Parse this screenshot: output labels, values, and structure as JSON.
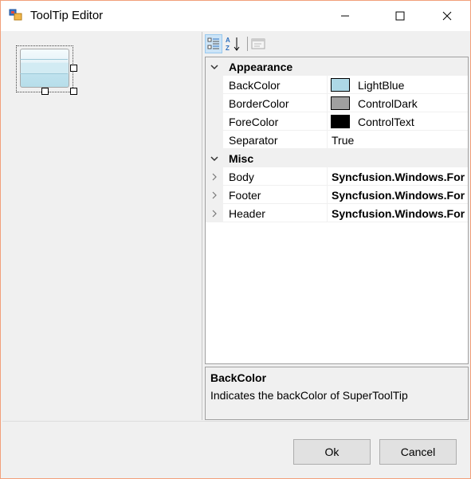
{
  "window": {
    "title": "ToolTip Editor"
  },
  "property_grid": {
    "categories": [
      {
        "label": "Appearance",
        "items": [
          {
            "name": "BackColor",
            "value": "LightBlue",
            "swatch": "#add8e6"
          },
          {
            "name": "BorderColor",
            "value": "ControlDark",
            "swatch": "#a0a0a0"
          },
          {
            "name": "ForeColor",
            "value": "ControlText",
            "swatch": "#000000"
          },
          {
            "name": "Separator",
            "value": "True"
          }
        ]
      },
      {
        "label": "Misc",
        "items": [
          {
            "name": "Body",
            "value": "Syncfusion.Windows.For"
          },
          {
            "name": "Footer",
            "value": "Syncfusion.Windows.For"
          },
          {
            "name": "Header",
            "value": "Syncfusion.Windows.For"
          }
        ]
      }
    ]
  },
  "help": {
    "title": "BackColor",
    "description": "Indicates the backColor of SuperToolTip"
  },
  "buttons": {
    "ok": "Ok",
    "cancel": "Cancel"
  },
  "colors": {
    "window_border": "#f2a07a",
    "selection": "#cce4f7",
    "gridline": "#f0f0f0"
  }
}
